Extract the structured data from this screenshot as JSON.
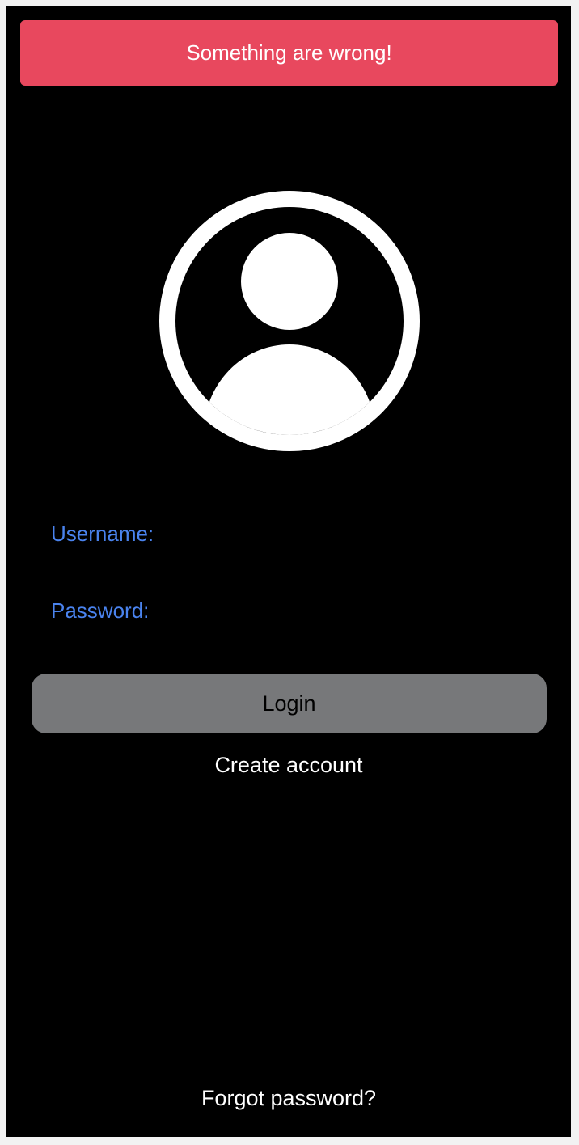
{
  "error_banner": {
    "message": "Something are wrong!",
    "color": "#e8485e"
  },
  "avatar": {
    "icon": "user-circle-icon"
  },
  "form": {
    "username_label": "Username:",
    "username_value": "",
    "password_label": "Password:",
    "password_value": "",
    "label_color": "#4a83ee"
  },
  "actions": {
    "login_label": "Login",
    "login_color": "#77787a",
    "create_account_label": "Create account",
    "forgot_password_label": "Forgot password?"
  }
}
